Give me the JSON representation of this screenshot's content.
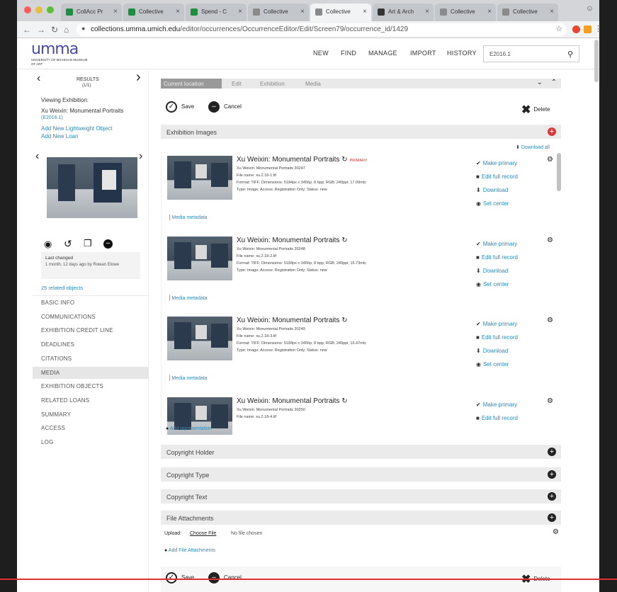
{
  "browser": {
    "tabs": [
      {
        "label": "CollAcc Pr",
        "icon_color": "#1e8e3e",
        "active": false
      },
      {
        "label": "Collective",
        "icon_color": "#1e8e3e",
        "active": false
      },
      {
        "label": "Spend - C",
        "icon_color": "#1e8e3e",
        "active": false
      },
      {
        "label": "Collective",
        "icon_color": "#8a8a8a",
        "active": false
      },
      {
        "label": "Collective",
        "icon_color": "#8a8a8a",
        "active": true
      },
      {
        "label": "Art & Arch",
        "icon_color": "#333333",
        "active": false
      },
      {
        "label": "Collective",
        "icon_color": "#8a8a8a",
        "active": false
      },
      {
        "label": "Collective",
        "icon_color": "#8a8a8a",
        "active": false
      }
    ],
    "url_host": "collections.umma.umich.edu",
    "url_path": "/editor/occurrences/OccurrenceEditor/Edit/Screen79/occurrence_id/1429"
  },
  "header": {
    "logo": "umma",
    "logo_sub": "UNIVERSITY OF MICHIGAN MUSEUM OF ART",
    "nav": [
      "NEW",
      "FIND",
      "MANAGE",
      "IMPORT",
      "HISTORY"
    ],
    "search_value": "E2016.1"
  },
  "sidebar": {
    "results_label": "RESULTS",
    "results_count": "(1/1)",
    "viewing_label": "Viewing Exhibition:",
    "exhibition_title": "Xu Weixin: Monumental Portraits",
    "exhibition_id": "(E2016.1)",
    "add_lightweight": "Add New Lightweight Object",
    "add_loan": "Add New Loan",
    "last_changed_label": "Last changed",
    "last_changed_value": "1 month, 12 days ago by Rowan Elowe",
    "related_objects": "25 related objects",
    "nav": [
      "BASIC INFO",
      "COMMUNICATIONS",
      "EXHIBITION CREDIT LINE",
      "DEADLINES",
      "CITATIONS",
      "MEDIA",
      "EXHIBITION OBJECTS",
      "RELATED LOANS",
      "SUMMARY",
      "ACCESS",
      "LOG"
    ],
    "selected_nav": "MEDIA"
  },
  "main": {
    "breadcrumbs": [
      "Current location",
      "Edit",
      "Exhibition",
      "Media"
    ],
    "save_label": "Save",
    "cancel_label": "Cancel",
    "delete_label": "Delete",
    "section_title": "Exhibition Images",
    "download_all": "Download all",
    "media_items": [
      {
        "title": "Xu Weixin: Monumental Portraits",
        "badge": "PRIMARY",
        "caption": "Xu Weixin: Monumental Portraits 30247",
        "file": "File name: xu.2.18-1.tif",
        "format": "Format: TIFF; Dimensions: 5184px x 3456p; 8 bpp; RGB; 240ppi; 17.09mb;",
        "type": "Type: Image; Access: Registration Only; Status: new",
        "actions": [
          "Make primary",
          "Edit full record",
          "Download",
          "Set center"
        ]
      },
      {
        "title": "Xu Weixin: Monumental Portraits",
        "badge": "",
        "caption": "Xu Weixin: Monumental Portraits 30248",
        "file": "File name: xu.2.18-2.tif",
        "format": "Format: TIFF; Dimensions: 5184px x 3456p; 8 bpp; RGB; 240ppi; 16.73mb;",
        "type": "Type: Image; Access: Registration Only; Status: new",
        "actions": [
          "Make primary",
          "Edit full record",
          "Download",
          "Set center"
        ]
      },
      {
        "title": "Xu Weixin: Monumental Portraits",
        "badge": "",
        "caption": "Xu Weixin: Monumental Portraits 30249",
        "file": "File name: xu.2.18-3.tif",
        "format": "Format: TIFF; Dimensions: 5184px x 3456p; 8 bpp; RGB; 240ppi; 16.47mb;",
        "type": "Type: Image; Access: Registration Only; Status: new",
        "actions": [
          "Make primary",
          "Edit full record",
          "Download",
          "Set center"
        ]
      },
      {
        "title": "Xu Weixin: Monumental Portraits",
        "badge": "",
        "caption": "Xu Weixin: Monumental Portraits 30250",
        "file": "File name: xu.2.18-4.tif",
        "format": "",
        "type": "",
        "actions": [
          "Make primary",
          "Edit full record"
        ]
      }
    ],
    "media_metadata": "Media metadata",
    "add_representation": "Add representation -",
    "panels": [
      "Copyright Holder",
      "Copyright Type",
      "Copyright Text",
      "File Attachments"
    ],
    "upload_label": "Upload:",
    "choose_file": "Choose File",
    "no_file": "No file chosen",
    "add_file_attachments": "Add File Attachments"
  }
}
